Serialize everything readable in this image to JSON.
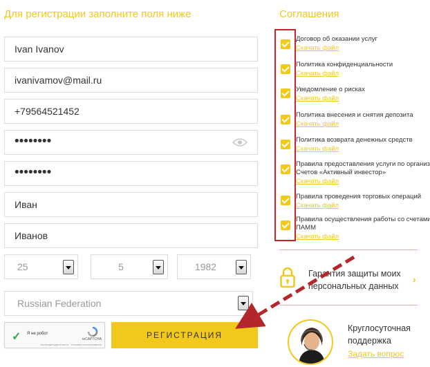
{
  "registration": {
    "heading": "Для регистрации заполните поля ниже",
    "full_name": "Ivan Ivanov",
    "email": "ivanivamov@mail.ru",
    "phone": "+79564521452",
    "password": "••••••••",
    "password_confirm": "••••••••",
    "first_name": "Иван",
    "last_name": "Иванов",
    "birth_day": "25",
    "birth_month": "5",
    "birth_year": "1982",
    "country": "Russian Federation",
    "submit_label": "Регистрация"
  },
  "captcha": {
    "label": "Я не робот",
    "brand": "reCAPTCHA",
    "terms": "Конфиденциальность · Условия использования"
  },
  "agreements": {
    "heading": "Соглашения",
    "download_label": "Скачать файл",
    "items": [
      {
        "title": "Договор об оказании услуг",
        "checked": true
      },
      {
        "title": "Политика конфиденциальности",
        "checked": true
      },
      {
        "title": "Уведомление о рисках",
        "checked": true
      },
      {
        "title": "Политика внесения и снятия депозита",
        "checked": true
      },
      {
        "title": "Политика возврата денежных средств",
        "checked": true
      },
      {
        "title": "Правила предоставления услуги по организа",
        "title_line2": "Счетов «Активный инвестор»",
        "checked": true
      },
      {
        "title": "Правила проведения торговых операций",
        "checked": true
      },
      {
        "title": "Правила осуществления работы со счетами т",
        "title_line2": "ПАММ",
        "checked": true
      }
    ]
  },
  "guarantee": {
    "line1": "Гарантия защиты моих",
    "line2": "персональных данных"
  },
  "support": {
    "line1": "Круглосуточная",
    "line2": "поддержка",
    "link": "Задать вопрос"
  },
  "colors": {
    "accent": "#f2c81a",
    "highlight_red": "#c4262b",
    "arrow": "#b3262a"
  }
}
